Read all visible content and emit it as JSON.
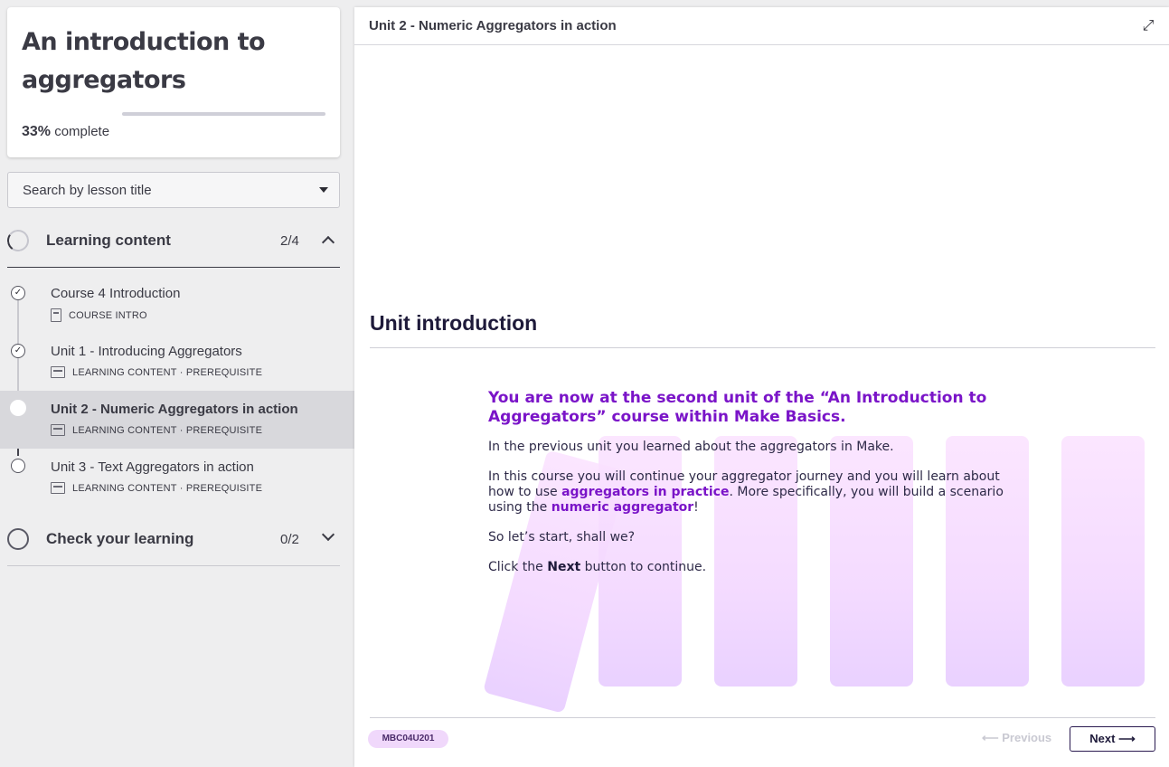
{
  "course": {
    "title": "An introduction to aggregators",
    "progress_percent": 33,
    "progress_pct_label": "33%",
    "progress_suffix": "complete"
  },
  "search": {
    "placeholder": "Search by lesson title"
  },
  "sections": [
    {
      "title": "Learning content",
      "count": "2/4",
      "expanded": true,
      "lessons": [
        {
          "name": "Course 4 Introduction",
          "meta": "COURSE INTRO",
          "status": "done",
          "icon": "document-icon"
        },
        {
          "name": "Unit 1 - Introducing Aggregators",
          "meta": "LEARNING CONTENT · PREREQUISITE",
          "status": "done",
          "icon": "slides-icon"
        },
        {
          "name": "Unit 2 - Numeric Aggregators in action",
          "meta": "LEARNING CONTENT · PREREQUISITE",
          "status": "current",
          "icon": "slides-icon"
        },
        {
          "name": "Unit 3 - Text Aggregators in action",
          "meta": "LEARNING CONTENT · PREREQUISITE",
          "status": "todo",
          "icon": "slides-icon"
        }
      ]
    },
    {
      "title": "Check your learning",
      "count": "0/2",
      "expanded": false
    }
  ],
  "main": {
    "topbar_title": "Unit 2 - Numeric Aggregators in action",
    "heading": "Unit introduction",
    "lead": "You are now at the second unit of the “An Introduction to Aggregators” course within Make Basics.",
    "p1": "In the previous unit you learned about the aggregators in Make.",
    "p2_before": "In this course you will continue your aggregator journey and you will learn about how to use ",
    "p2_hl1": "aggregators in practice",
    "p2_mid": ". More specifically, you will build a scenario using the ",
    "p2_hl2": "numeric aggregator",
    "p2_end": "!",
    "p3": "So let’s start, shall we?",
    "p4_before": "Click the ",
    "p4_bold": "Next",
    "p4_after": " button to continue.",
    "accent_color": "#7a14c8"
  },
  "footer": {
    "code": "MBC04U201",
    "previous_label": "⟵ Previous",
    "next_label": "Next ⟶"
  }
}
